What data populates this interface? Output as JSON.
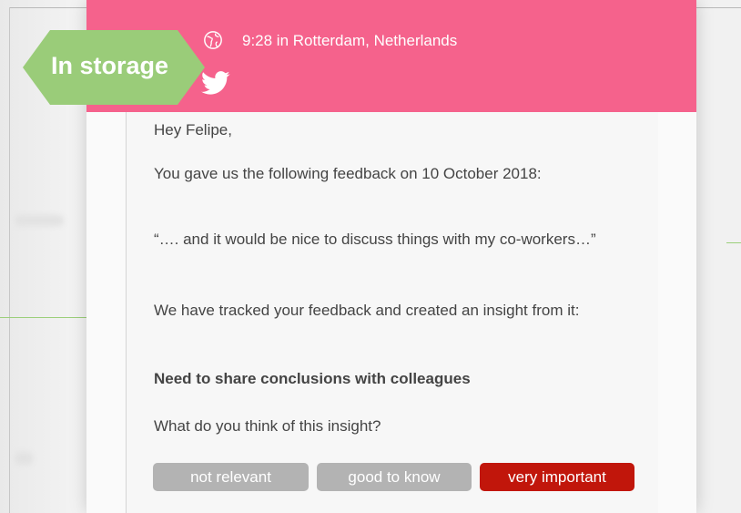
{
  "header": {
    "time_location": "9:28 in Rotterdam, Netherlands",
    "color": "#f5628c"
  },
  "badge": {
    "label": "In storage",
    "color": "#9acc79"
  },
  "message": {
    "greeting": "Hey Felipe,",
    "intro": "You gave us the following feedback on 10 October 2018:",
    "quote": "“…. and it would be nice to discuss things with my co-workers…”",
    "tracked": "We have tracked your feedback and created an insight from it:",
    "insight": "Need to share conclusions with colleagues",
    "question": "What do you think of this insight?"
  },
  "actions": {
    "not_relevant": "not relevant",
    "good_to_know": "good to know",
    "very_important": "very important"
  },
  "icons": {
    "globe": "globe-icon",
    "twitter": "twitter-icon"
  }
}
